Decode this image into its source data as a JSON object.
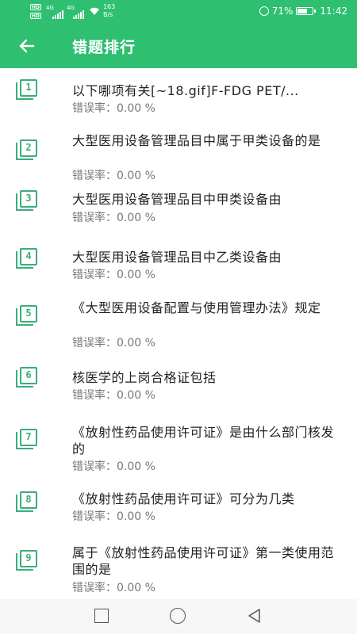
{
  "status_bar": {
    "network_type": "4G",
    "hd_label": "HD",
    "speed_value": "163",
    "speed_unit": "B/s",
    "battery_percent": "71%",
    "battery_level": 0.71,
    "time": "11:42"
  },
  "app_bar": {
    "back_icon": "arrow-left-icon",
    "title": "错题排行"
  },
  "rate_label": "错误率：",
  "questions": [
    {
      "rank": "1",
      "title": "以下哪项有关[~18.gif]F-FDG PET/...",
      "rate": "错误率：0.00 %"
    },
    {
      "rank": "2",
      "title": "大型医用设备管理品目中属于甲类设备的是",
      "rate": "错误率：0.00 %"
    },
    {
      "rank": "3",
      "title": "大型医用设备管理品目中甲类设备由",
      "rate": "错误率：0.00 %"
    },
    {
      "rank": "4",
      "title": "大型医用设备管理品目中乙类设备由",
      "rate": "错误率：0.00 %"
    },
    {
      "rank": "5",
      "title": "《大型医用设备配置与使用管理办法》规定",
      "rate": "错误率：0.00 %"
    },
    {
      "rank": "6",
      "title": "核医学的上岗合格证包括",
      "rate": "错误率：0.00 %"
    },
    {
      "rank": "7",
      "title": "《放射性药品使用许可证》是由什么部门核发的",
      "rate": "错误率：0.00 %"
    },
    {
      "rank": "8",
      "title": "《放射性药品使用许可证》可分为几类",
      "rate": "错误率：0.00 %"
    },
    {
      "rank": "9",
      "title": "属于《放射性药品使用许可证》第一类使用范围的是",
      "rate": "错误率：0.00 %"
    }
  ],
  "nav_bar": {
    "recent_icon": "square-icon",
    "home_icon": "circle-icon",
    "back_icon": "triangle-back-icon"
  },
  "colors": {
    "primary": "#2fbf71",
    "icon_green": "#3aae7a",
    "text": "#222222",
    "subtext": "#777777"
  }
}
